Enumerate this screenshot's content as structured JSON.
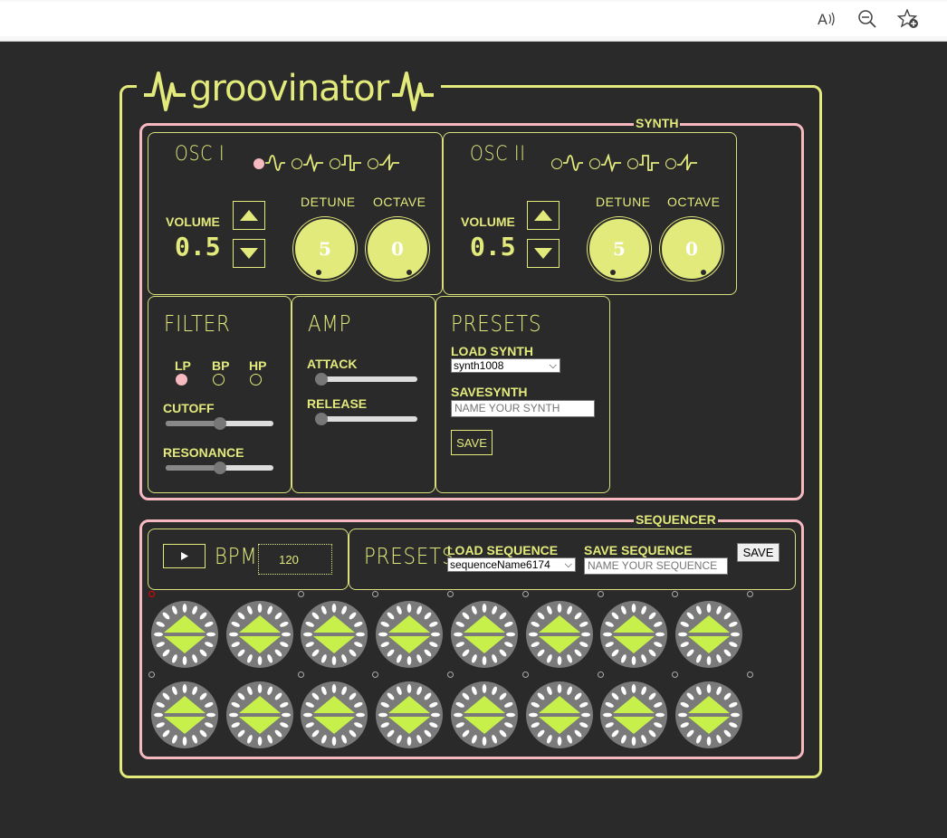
{
  "browser": {
    "read_aloud_icon": "read-aloud-icon",
    "zoom_out_icon": "zoom-out-icon",
    "favorites_icon": "add-favorite-icon"
  },
  "app": {
    "title": "groovinator",
    "accent": "#e3ea7c",
    "section_border": "#f6b9c0"
  },
  "synth": {
    "title": "SYNTH",
    "osc1": {
      "title": "OSC I",
      "waveforms": [
        "sine",
        "triangle",
        "square",
        "sawtooth"
      ],
      "selected_wave": 0,
      "volume_label": "VOLUME",
      "volume": "0.5",
      "detune_label": "DETUNE",
      "detune": "5",
      "octave_label": "OCTAVE",
      "octave": "0"
    },
    "osc2": {
      "title": "OSC II",
      "waveforms": [
        "sine",
        "triangle",
        "square",
        "sawtooth"
      ],
      "selected_wave": -1,
      "volume_label": "VOLUME",
      "volume": "0.5",
      "detune_label": "DETUNE",
      "detune": "5",
      "octave_label": "OCTAVE",
      "octave": "0"
    },
    "filter": {
      "title": "FILTER",
      "types": [
        "LP",
        "BP",
        "HP"
      ],
      "selected_type": "LP",
      "cutoff_label": "CUTOFF",
      "cutoff": 0.5,
      "resonance_label": "RESONANCE",
      "resonance": 0.5
    },
    "amp": {
      "title": "AMP",
      "attack_label": "ATTACK",
      "attack": 0,
      "release_label": "RELEASE",
      "release": 0
    },
    "presets": {
      "title": "PRESETS",
      "load_label": "LOAD SYNTH",
      "load_value": "synth1008",
      "save_label": "SAVESYNTH",
      "name_placeholder": "NAME YOUR SYNTH",
      "save_button": "SAVE"
    }
  },
  "sequencer": {
    "title": "SEQUENCER",
    "play_icon": "play-icon",
    "bpm_label": "BPM",
    "bpm": "120",
    "presets_title": "PRESETS",
    "load_label": "LOAD SEQUENCE",
    "load_value": "sequenceName6174",
    "save_label": "SAVE SEQUENCE",
    "name_placeholder": "NAME YOUR SEQUENCE",
    "save_button": "SAVE",
    "rows": 2,
    "steps": 8,
    "active_step": 0,
    "pad_color": "#c8f04a"
  }
}
